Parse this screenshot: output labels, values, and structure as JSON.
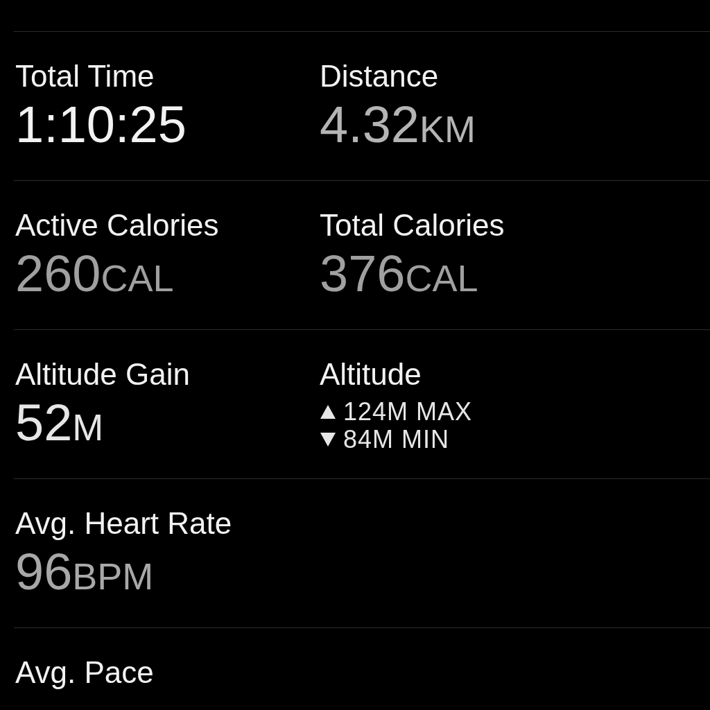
{
  "rows": [
    {
      "metrics": [
        {
          "kind": "value",
          "label": "Total Time",
          "value": "1:10:25",
          "color": "#f2f2f2"
        },
        {
          "kind": "value",
          "label": "Distance",
          "value": "4.32",
          "unit": "KM",
          "color": "#b4b4b4"
        }
      ]
    },
    {
      "metrics": [
        {
          "kind": "value",
          "label": "Active Calories",
          "value": "260",
          "unit": "CAL",
          "color": "#a0a0a0"
        },
        {
          "kind": "value",
          "label": "Total Calories",
          "value": "376",
          "unit": "CAL",
          "color": "#a0a0a0"
        }
      ]
    },
    {
      "metrics": [
        {
          "kind": "value",
          "label": "Altitude Gain",
          "value": "52",
          "unit": "M",
          "color": "#e6e6e6"
        },
        {
          "kind": "range",
          "label": "Altitude",
          "lines": [
            {
              "kind": "up",
              "text": "124M MAX"
            },
            {
              "kind": "down",
              "text": "84M MIN"
            }
          ],
          "color": "#e6e6e6"
        }
      ]
    },
    {
      "metrics": [
        {
          "kind": "value",
          "label": "Avg. Heart Rate",
          "value": "96",
          "unit": "BPM",
          "color": "#a8a8a8"
        }
      ]
    },
    {
      "metrics": [
        {
          "kind": "value",
          "label": "Avg. Pace"
        }
      ]
    }
  ]
}
